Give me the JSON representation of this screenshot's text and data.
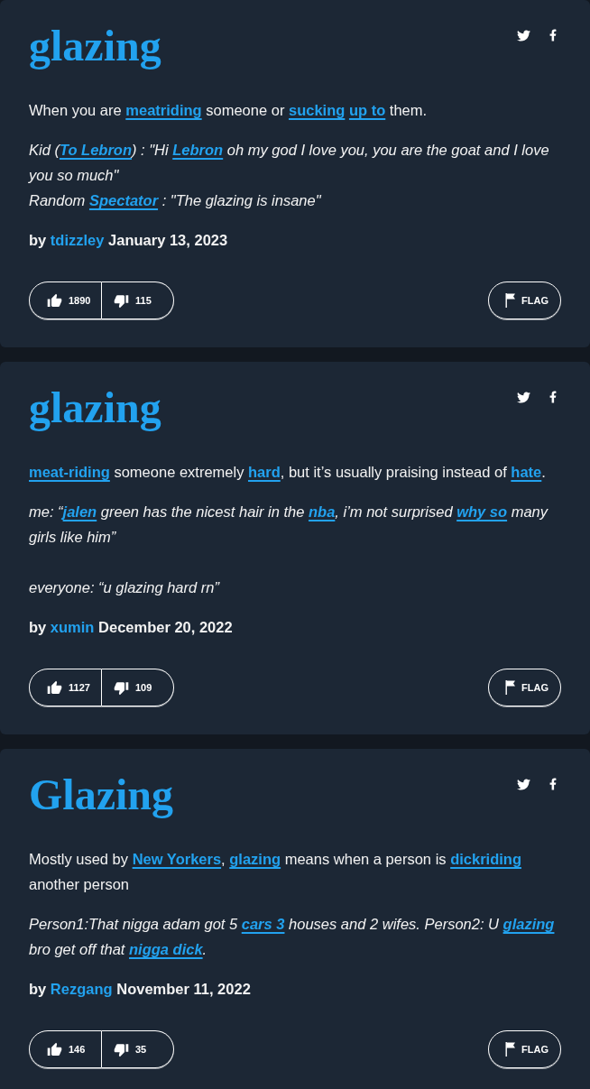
{
  "entries": [
    {
      "word": "glazing",
      "meaning": [
        {
          "kind": "text",
          "text": "When you are "
        },
        {
          "kind": "link",
          "text": "meatriding"
        },
        {
          "kind": "text",
          "text": " someone or "
        },
        {
          "kind": "link",
          "text": "sucking"
        },
        {
          "kind": "link",
          "text": "up to"
        },
        {
          "kind": "text",
          "text": " them."
        }
      ],
      "example": [
        {
          "lines": [
            {
              "segments": [
                {
                  "kind": "text",
                  "text": "Kid ("
                },
                {
                  "kind": "link",
                  "text": "To Lebron"
                },
                {
                  "kind": "text",
                  "text": ") : \"Hi "
                },
                {
                  "kind": "link",
                  "text": "Lebron"
                },
                {
                  "kind": "text",
                  "text": " oh my god I love you, you are the goat and I love you so much\""
                }
              ]
            },
            {
              "segments": [
                {
                  "kind": "text",
                  "text": "Random "
                },
                {
                  "kind": "link",
                  "text": "Spectator"
                },
                {
                  "kind": "text",
                  "text": " : \"The glazing is insane\""
                }
              ]
            }
          ]
        }
      ],
      "byline": {
        "prefix": "by",
        "author": "tdizzley",
        "date": "January 13, 2023"
      },
      "votes": {
        "up": "1890",
        "down": "115"
      },
      "flag": "FLAG"
    },
    {
      "word": "glazing",
      "meaning": [
        {
          "kind": "link",
          "text": "meat-riding"
        },
        {
          "kind": "text",
          "text": " someone extremely "
        },
        {
          "kind": "link",
          "text": "hard"
        },
        {
          "kind": "text",
          "text": ", but it’s usually praising instead of "
        },
        {
          "kind": "link",
          "text": "hate"
        },
        {
          "kind": "text",
          "text": "."
        }
      ],
      "example": [
        {
          "lines": [
            {
              "segments": [
                {
                  "kind": "text",
                  "text": "me: “"
                },
                {
                  "kind": "link",
                  "text": "jalen"
                },
                {
                  "kind": "text",
                  "text": " green has the nicest hair in the "
                },
                {
                  "kind": "link",
                  "text": "nba"
                },
                {
                  "kind": "text",
                  "text": ", i’m not surprised "
                },
                {
                  "kind": "link",
                  "text": "why so"
                },
                {
                  "kind": "text",
                  "text": " many girls like him”"
                }
              ]
            }
          ]
        },
        {
          "lines": [
            {
              "segments": [
                {
                  "kind": "text",
                  "text": "everyone: “u glazing hard rn”"
                }
              ]
            }
          ]
        }
      ],
      "byline": {
        "prefix": "by",
        "author": "xumin",
        "date": "December 20, 2022"
      },
      "votes": {
        "up": "1127",
        "down": "109"
      },
      "flag": "FLAG"
    },
    {
      "word": "Glazing",
      "meaning": [
        {
          "kind": "text",
          "text": "Mostly used by "
        },
        {
          "kind": "link",
          "text": "New Yorkers"
        },
        {
          "kind": "text",
          "text": ", "
        },
        {
          "kind": "link",
          "text": "glazing"
        },
        {
          "kind": "text",
          "text": " means when a person is "
        },
        {
          "kind": "link",
          "text": "dickriding"
        },
        {
          "kind": "text",
          "text": " another person"
        }
      ],
      "example": [
        {
          "lines": [
            {
              "segments": [
                {
                  "kind": "text",
                  "text": "Person1:That nigga adam got 5 "
                },
                {
                  "kind": "link",
                  "text": "cars 3"
                },
                {
                  "kind": "text",
                  "text": " houses and 2 wifes. Person2: U "
                },
                {
                  "kind": "link",
                  "text": "glazing"
                },
                {
                  "kind": "text",
                  "text": " bro get off that "
                },
                {
                  "kind": "link",
                  "text": "nigga dick"
                },
                {
                  "kind": "text",
                  "text": "."
                }
              ]
            }
          ]
        }
      ],
      "byline": {
        "prefix": "by",
        "author": "Rezgang",
        "date": "November 11, 2022"
      },
      "votes": {
        "up": "146",
        "down": "35"
      },
      "flag": "FLAG"
    }
  ]
}
